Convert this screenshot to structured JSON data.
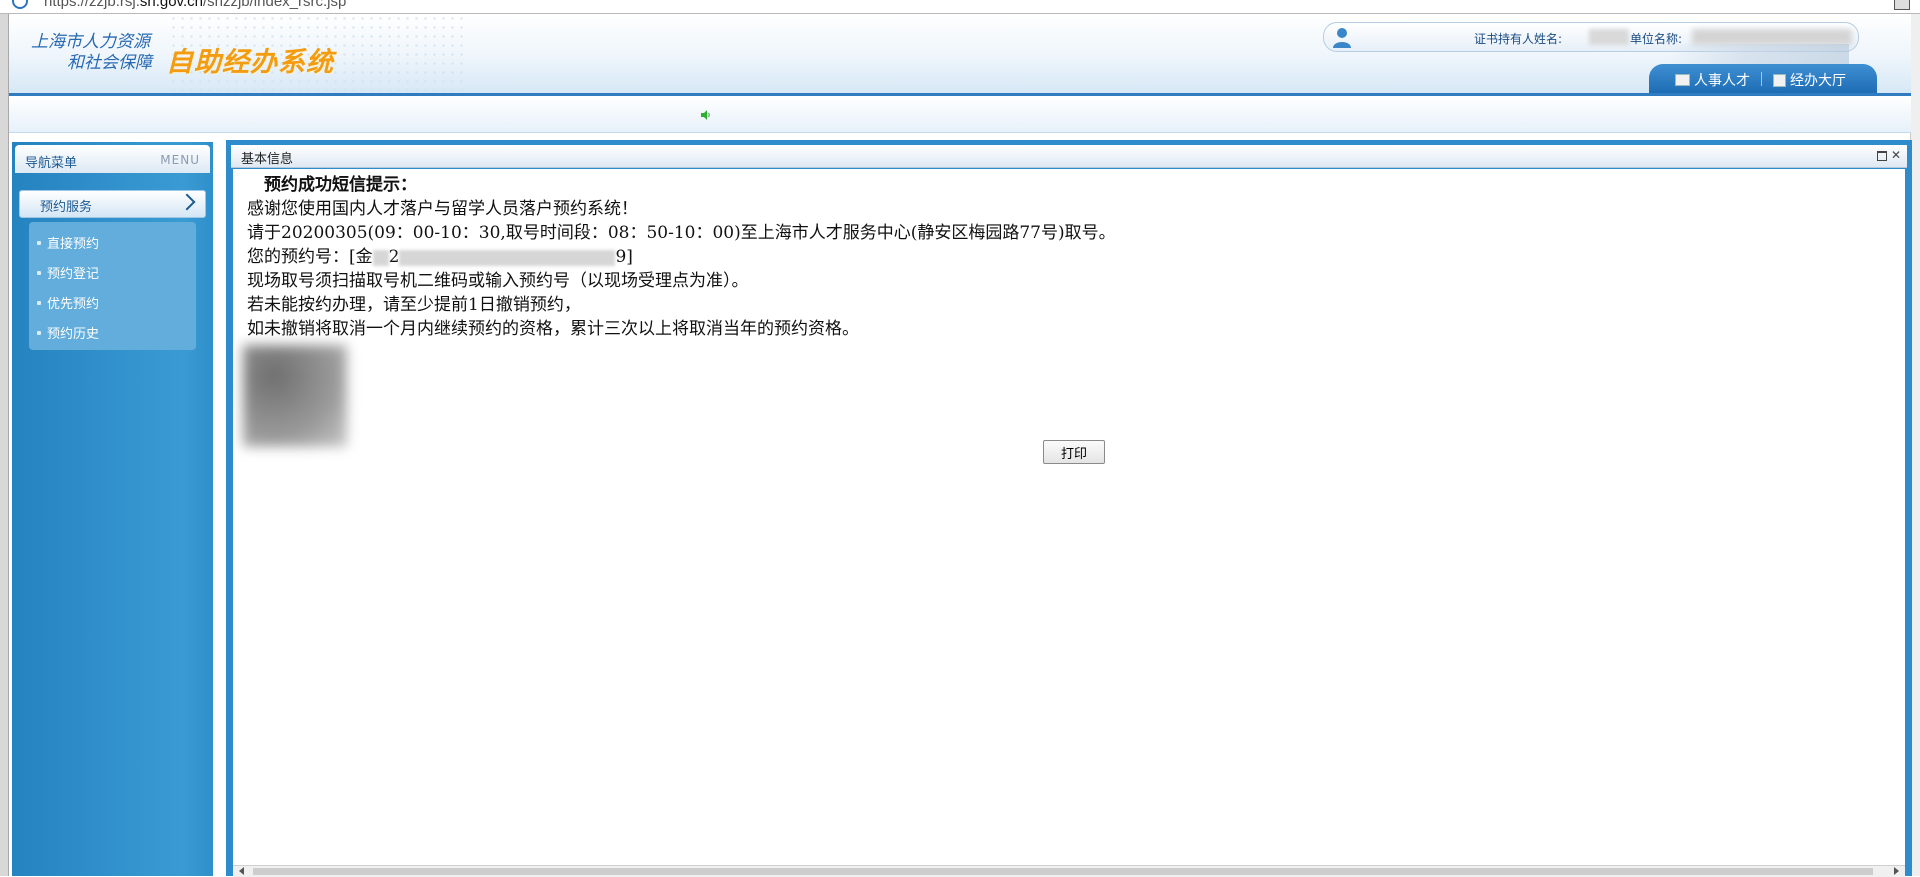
{
  "browser": {
    "url_prefix": "https://zzjb.rsj.",
    "url_host": "sh.gov.cn",
    "url_path": "/shzzjb/index_rsrc.jsp"
  },
  "header": {
    "org_line1": "上海市人力资源",
    "org_line2": "和社会保障",
    "system_name": "自助经办系统",
    "holder_label": "证书持有人姓名:",
    "unit_label": "单位名称:",
    "tabs": [
      "人事人才",
      "经办大厅"
    ]
  },
  "sidebar": {
    "title": "导航菜单",
    "menu_label": "MENU",
    "section": "预约服务",
    "items": [
      "直接预约",
      "预约登记",
      "优先预约",
      "预约历史"
    ]
  },
  "panel": {
    "title": "基本信息"
  },
  "message": {
    "title": "预约成功短信提示：",
    "line1": "感谢您使用国内人才落户与留学人员落户预约系统！",
    "line2": "请于20200305(09：00-10：30,取号时间段：08：50-10：00)至上海市人才服务中心(静安区梅园路77号)取号。",
    "line3_prefix": "您的预约号：[金",
    "line3_mid": "2",
    "line3_suffix": "9]",
    "line4": "现场取号须扫描取号机二维码或输入预约号（以现场受理点为准）。",
    "line5": "若未能按约办理，请至少提前1日撤销预约，",
    "line6": "如未撤销将取消一个月内继续预约的资格，累计三次以上将取消当年的预约资格。"
  },
  "actions": {
    "print_label": "打印"
  },
  "colors": {
    "brand_blue": "#2f7cc0",
    "logo_orange": "#f39c12",
    "sidebar_blue": "#2b8cc7"
  }
}
